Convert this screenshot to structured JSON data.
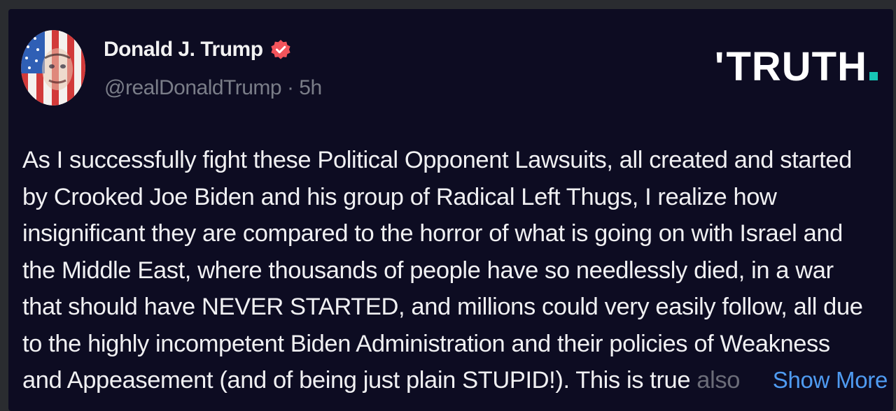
{
  "post": {
    "author": {
      "display_name": "Donald J. Trump",
      "handle": "@realDonaldTrump",
      "separator": "·",
      "time_ago": "5h",
      "verified_icon": "verified-badge-icon",
      "avatar_icon": "flag-portrait-avatar"
    },
    "brand": {
      "name": "TRUTH",
      "apostrophe": "'",
      "accent_color": "#17c6b6"
    },
    "body_lines": [
      "As I successfully fight these Political Opponent Lawsuits, all created and started",
      "by Crooked Joe Biden and his group of Radical Left Thugs, I realize how",
      "insignificant they are compared to the horror of what is going on with Israel and",
      "the Middle East, where thousands of people have so needlessly died, in a war",
      "that should have NEVER STARTED, and millions could very easily follow, all due",
      "to the highly incompetent Biden Administration and their policies of Weakness"
    ],
    "last_line_visible": "and Appeasement (and of being just plain STUPID!). This is true ",
    "last_line_faded": "also",
    "show_more_label": "Show More",
    "colors": {
      "background": "#0d0c22",
      "link": "#4f9bf1",
      "muted_text": "#7a7d88",
      "verified_badge": "#f2545b"
    }
  }
}
